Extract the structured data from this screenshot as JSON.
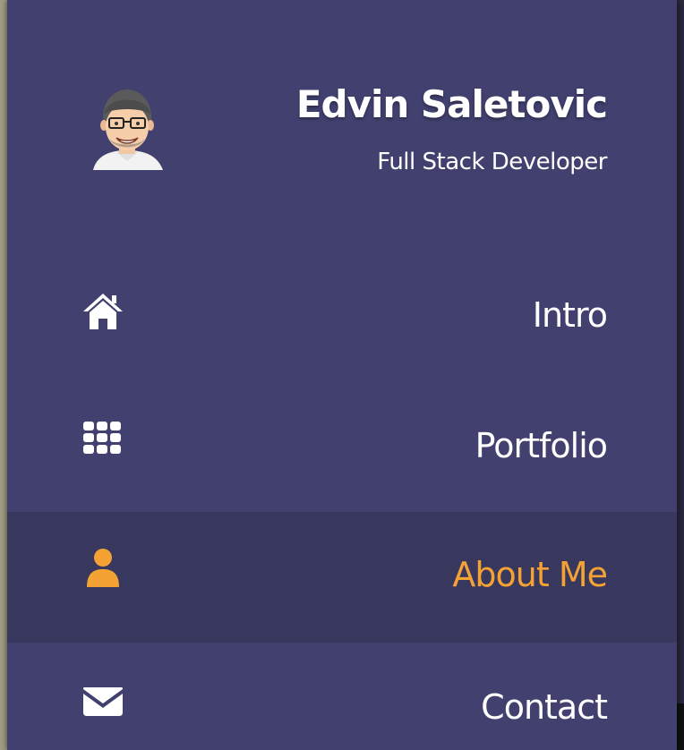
{
  "profile": {
    "name": "Edvin Saletovic",
    "role": "Full Stack Developer"
  },
  "nav": {
    "items": [
      {
        "label": "Intro",
        "icon": "home-icon",
        "active": false
      },
      {
        "label": "Portfolio",
        "icon": "grid-icon",
        "active": false
      },
      {
        "label": "About Me",
        "icon": "user-icon",
        "active": true
      },
      {
        "label": "Contact",
        "icon": "envelope-icon",
        "active": false
      }
    ]
  },
  "colors": {
    "sidebar_bg": "#41406f",
    "active_bg": "#38375e",
    "accent": "#f4a234",
    "text": "#ffffff"
  }
}
